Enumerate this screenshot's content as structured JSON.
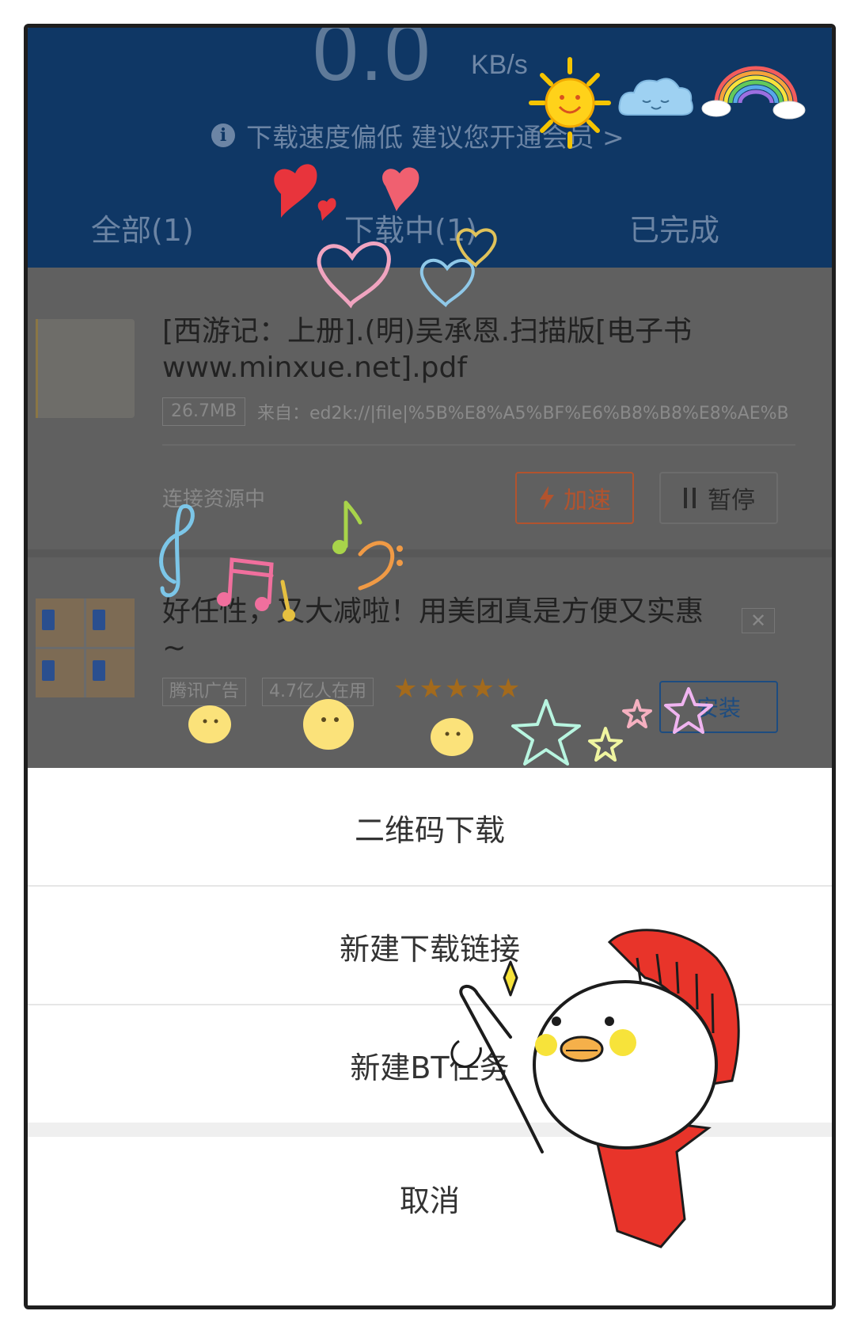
{
  "header": {
    "speed_value": "0.0",
    "speed_unit": "KB/s",
    "hint_text": "下载速度偏低 建议您开通会员 >",
    "tabs": [
      {
        "label": "全部(1)"
      },
      {
        "label": "下载中(1)"
      },
      {
        "label": "已完成"
      }
    ]
  },
  "download_item": {
    "title": "[西游记：上册].(明)吴承恩.扫描版[电子书www.minxue.net].pdf",
    "size": "26.7MB",
    "source": "来自：ed2k://|file|%5B%E8%A5%BF%E6%B8%B8%E8%AE%B0%...",
    "status": "连接资源中",
    "accelerate_label": "加速",
    "pause_label": "暂停"
  },
  "ad": {
    "title": "好任性，又大减啦！用美团真是方便又实惠~",
    "tag_source": "腾讯广告",
    "tag_users": "4.7亿人在用",
    "stars": "★★★★★",
    "rating": 5,
    "install_label": "安装"
  },
  "action_sheet": {
    "items": [
      {
        "label": "二维码下载"
      },
      {
        "label": "新建下载链接"
      },
      {
        "label": "新建BT任务"
      }
    ],
    "cancel_label": "取消"
  },
  "icons": [
    "info-icon",
    "lightning-icon",
    "pause-icon",
    "close-icon",
    "star-icon"
  ],
  "colors": {
    "header_bg": "#0f3765",
    "overlay_bg": "#606060",
    "accelerate": "#b2532e",
    "install": "#1d4c80",
    "stars": "#a36a1c"
  }
}
